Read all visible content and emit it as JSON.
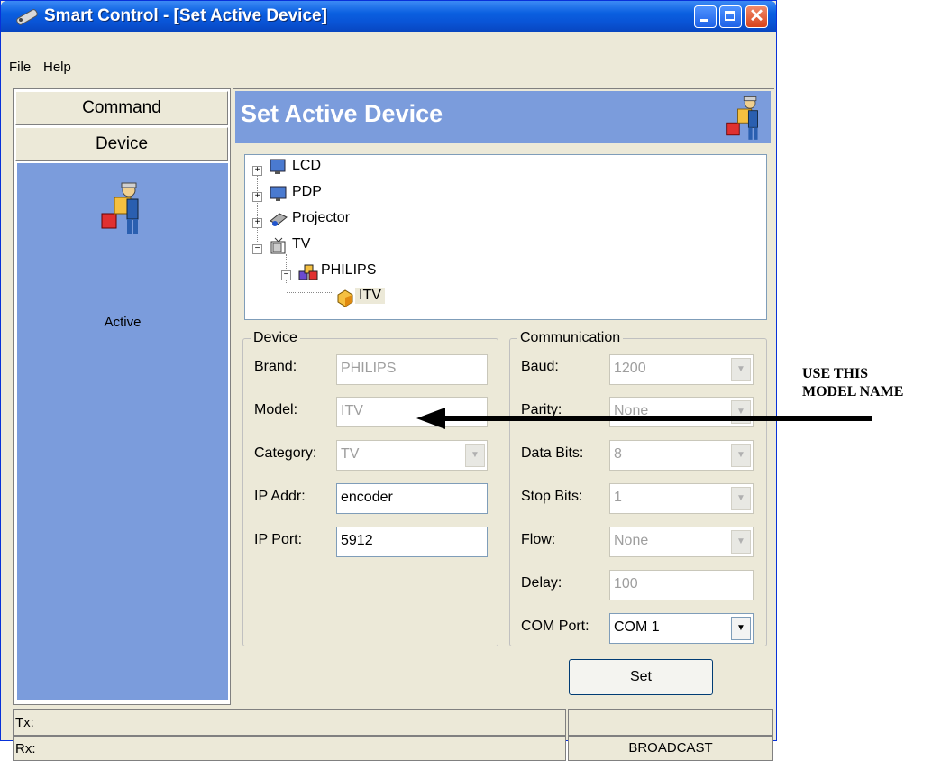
{
  "window": {
    "title": "Smart Control - [Set Active Device]"
  },
  "menu": [
    "File",
    "Help"
  ],
  "sidebar": {
    "tabs": [
      "Command",
      "Device"
    ],
    "active_item": "Active"
  },
  "header": {
    "title": "Set Active Device"
  },
  "tree": {
    "nodes": [
      "LCD",
      "PDP",
      "Projector",
      "TV"
    ],
    "tv_children": {
      "brand": "PHILIPS",
      "model": "ITV"
    }
  },
  "device": {
    "title": "Device",
    "brand_label": "Brand:",
    "brand_value": "PHILIPS",
    "model_label": "Model:",
    "model_value": "ITV",
    "category_label": "Category:",
    "category_value": "TV",
    "ip_label": "IP Addr:",
    "ip_value": "encoder",
    "port_label": "IP Port:",
    "port_value": "5912"
  },
  "comm": {
    "title": "Communication",
    "baud_label": "Baud:",
    "baud_value": "1200",
    "parity_label": "Parity:",
    "parity_value": "None",
    "databits_label": "Data Bits:",
    "databits_value": "8",
    "stopbits_label": "Stop Bits:",
    "stopbits_value": "1",
    "flow_label": "Flow:",
    "flow_value": "None",
    "delay_label": "Delay:",
    "delay_value": "100",
    "com_label": "COM Port:",
    "com_value": "COM 1"
  },
  "buttons": {
    "set": "Set"
  },
  "status": {
    "tx_label": "Tx:",
    "rx_label": "Rx:",
    "mode": "BROADCAST"
  },
  "annotation": {
    "line1": "USE THIS",
    "line2": "MODEL NAME"
  },
  "colors": {
    "titlebar": "#0a5fe0",
    "panel": "#7b9cdc",
    "window_bg": "#ece9d8"
  }
}
